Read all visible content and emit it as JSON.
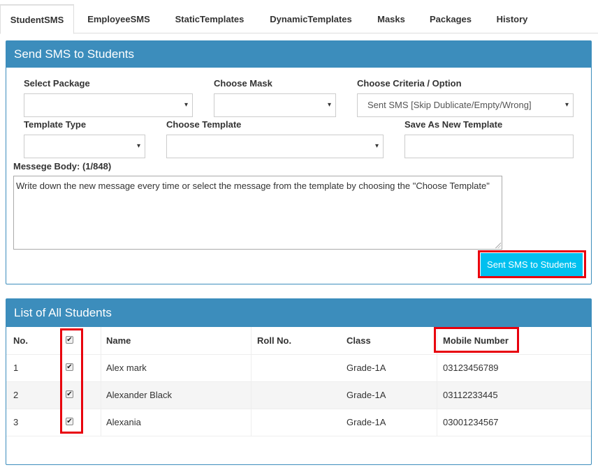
{
  "tabs": [
    "StudentSMS",
    "EmployeeSMS",
    "StaticTemplates",
    "DynamicTemplates",
    "Masks",
    "Packages",
    "History"
  ],
  "send_panel": {
    "title": "Send SMS to Students",
    "select_package_label": "Select Package",
    "select_package_value": "",
    "choose_mask_label": "Choose Mask",
    "choose_mask_value": "",
    "criteria_label": "Choose Criteria / Option",
    "criteria_value": "Sent SMS [Skip Dublicate/Empty/Wrong]",
    "template_type_label": "Template Type",
    "template_type_value": "",
    "choose_template_label": "Choose Template",
    "choose_template_value": "",
    "save_template_label": "Save As New Template",
    "save_template_value": "",
    "message_label": "Messege Body: (1/848)",
    "message_text": "Write down the new message every time or select the message from the template by choosing the  \"Choose Template\"",
    "send_button": "Sent SMS to Students",
    "caret": "▾"
  },
  "students_panel": {
    "title": "List of All Students",
    "columns": [
      "No.",
      "",
      "Name",
      "Roll No.",
      "Class",
      "Mobile Number"
    ],
    "rows": [
      {
        "no": "1",
        "checked": true,
        "name": "Alex mark",
        "roll": "",
        "class": "Grade-1A",
        "mobile": "03123456789"
      },
      {
        "no": "2",
        "checked": true,
        "name": "Alexander Black",
        "roll": "",
        "class": "Grade-1A",
        "mobile": "03112233445"
      },
      {
        "no": "3",
        "checked": true,
        "name": "Alexania",
        "roll": "",
        "class": "Grade-1A",
        "mobile": "03001234567"
      }
    ],
    "check_glyph": "✔"
  },
  "colors": {
    "panel_header": "#3c8dbc",
    "button": "#00c0ef",
    "highlight": "#e8000d"
  }
}
